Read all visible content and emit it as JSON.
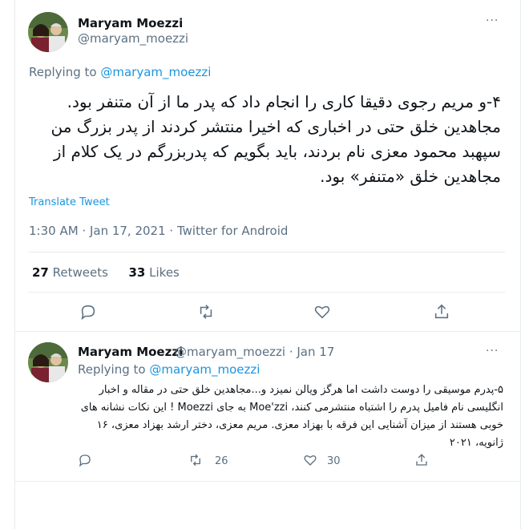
{
  "tweet": {
    "author_name": "Maryam Moezzi",
    "author_handle": "@maryam_moezzi",
    "replying_prefix": "Replying to",
    "replying_handle": "@maryam_moezzi",
    "text": "۴-و مریم رجوی دقیقا کاری را انجام داد که پدر ما از آن متنفر بود. مجاهدین خلق حتی در اخباری که اخیرا منتشر کردند از پدر بزرگ من سپهبد محمود معزی نام بردند، باید بگویم که پدربزرگم در یک کلام از مجاهدین خلق «متنفر» بود.",
    "translate": "Translate Tweet",
    "timestamp": "1:30 AM · Jan 17, 2021 · Twitter for Android",
    "retweets_count": "27",
    "retweets_label": "Retweets",
    "likes_count": "33",
    "likes_label": "Likes",
    "more": "···"
  },
  "reply": {
    "author_name": "Maryam Moezzi",
    "author_handle": "@maryam_moezzi · Jan 17",
    "replying_prefix": "Replying to",
    "replying_handle": "@maryam_moezzi",
    "text": "۵-پدرم موسیقی را دوست داشت اما هرگز ویالن نمیزد و...مجاهدین خلق حتی در مقاله و اخبار انگلیسی نام فامیل پدرم را اشتباه منتشرمی کنند، Moe'zzi به جای Moezzi ! این نکات نشانه های خوبی هستند از میزان آشنایی این فرقه با بهزاد معزی. مریم معزی، دختر ارشد بهزاد معزی، ۱۶ ژانویه، ۲۰۲۱",
    "retweets_count": "26",
    "likes_count": "30",
    "more": "···"
  },
  "icons": [
    "reply-icon",
    "retweet-icon",
    "like-icon",
    "share-icon",
    "more-icon"
  ],
  "colors": {
    "link": "#1b95e0",
    "muted": "#5b7083",
    "divider": "#e6ecf0"
  }
}
